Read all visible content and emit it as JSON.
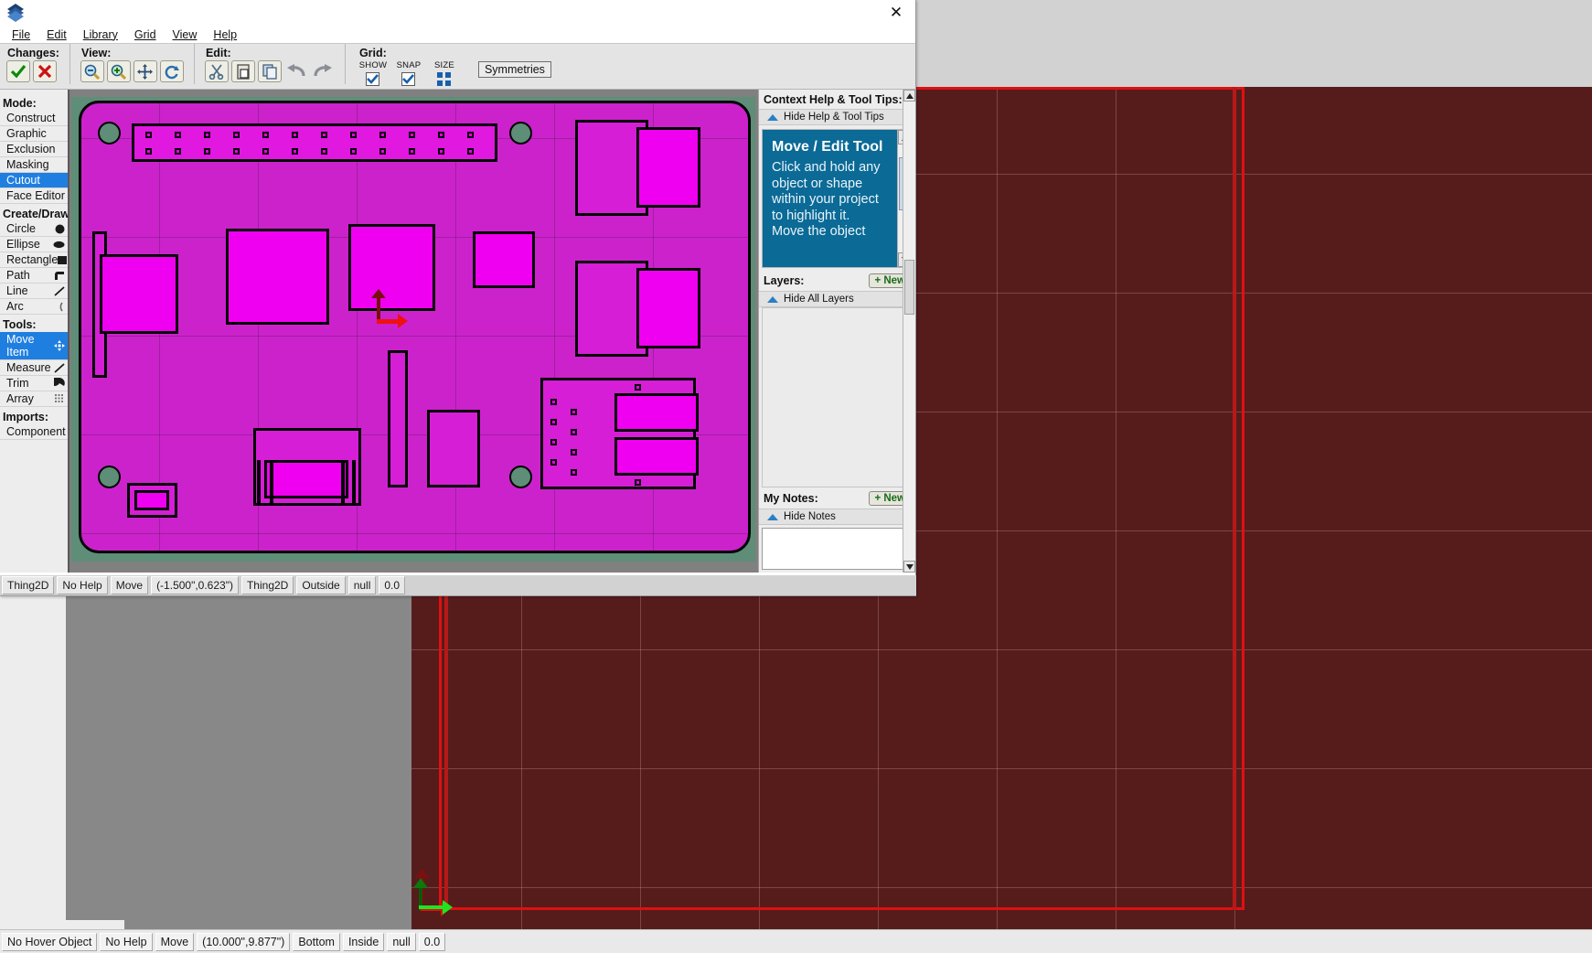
{
  "window": {
    "close_label": "✕",
    "logo_name": "app-logo"
  },
  "menubar": {
    "items": [
      {
        "label": "File"
      },
      {
        "label": "Edit"
      },
      {
        "label": "Library"
      },
      {
        "label": "Grid"
      },
      {
        "label": "View"
      },
      {
        "label": "Help"
      }
    ]
  },
  "toolbar": {
    "groups": [
      {
        "label": "Changes:",
        "buttons": [
          {
            "name": "accept-changes-button",
            "icon": "check-icon"
          },
          {
            "name": "cancel-changes-button",
            "icon": "x-icon"
          }
        ]
      },
      {
        "label": "View:",
        "buttons": [
          {
            "name": "zoom-out-button",
            "icon": "zoom-out-icon"
          },
          {
            "name": "zoom-in-button",
            "icon": "zoom-in-icon"
          },
          {
            "name": "pan-button",
            "icon": "move-arrows-icon"
          },
          {
            "name": "refresh-view-button",
            "icon": "refresh-icon"
          }
        ]
      },
      {
        "label": "Edit:",
        "buttons": [
          {
            "name": "cut-button",
            "icon": "scissors-icon"
          },
          {
            "name": "paste-button",
            "icon": "clipboard-icon"
          },
          {
            "name": "copy-button",
            "icon": "copy-icon"
          },
          {
            "name": "undo-button",
            "icon": "undo-arrow-icon"
          },
          {
            "name": "redo-button",
            "icon": "redo-arrow-icon"
          }
        ]
      }
    ],
    "grid": {
      "label": "Grid:",
      "show_label": "SHOW",
      "snap_label": "SNAP",
      "size_label": "SIZE",
      "show_checked": true,
      "snap_checked": true
    },
    "symmetries_label": "Symmetries"
  },
  "sidebar": {
    "mode": {
      "heading": "Mode:",
      "items": [
        {
          "label": "Construct",
          "selected": false
        },
        {
          "label": "Graphic",
          "selected": false
        },
        {
          "label": "Exclusion",
          "selected": false
        },
        {
          "label": "Masking",
          "selected": false
        },
        {
          "label": "Cutout",
          "selected": true
        },
        {
          "label": "Face Editor",
          "selected": false
        }
      ]
    },
    "create_draw": {
      "heading": "Create/Draw:",
      "items": [
        {
          "label": "Circle",
          "icon": "circle-icon"
        },
        {
          "label": "Ellipse",
          "icon": "ellipse-icon"
        },
        {
          "label": "Rectangle",
          "icon": "rectangle-icon"
        },
        {
          "label": "Path",
          "icon": "path-icon"
        },
        {
          "label": "Line",
          "icon": "line-icon"
        },
        {
          "label": "Arc",
          "icon": "arc-icon"
        }
      ]
    },
    "tools": {
      "heading": "Tools:",
      "items": [
        {
          "label": "Move Item",
          "icon": "move-item-icon",
          "selected": true
        },
        {
          "label": "Measure",
          "icon": "measure-icon",
          "selected": false
        },
        {
          "label": "Trim",
          "icon": "trim-icon",
          "selected": false
        },
        {
          "label": "Array",
          "icon": "array-icon",
          "selected": false
        }
      ]
    },
    "imports": {
      "heading": "Imports:",
      "items": [
        {
          "label": "Component"
        }
      ]
    }
  },
  "help_panel": {
    "header": "Context Help & Tool Tips:",
    "hide_label": "Hide Help & Tool Tips",
    "title": "Move / Edit Tool",
    "body": "Click and hold any object or shape within your project to highlight it.",
    "body_cut": "Move the object"
  },
  "layers_panel": {
    "header": "Layers:",
    "new_label": "+ New",
    "hide_label": "Hide All Layers"
  },
  "notes_panel": {
    "header": "My Notes:",
    "new_label": "+ New",
    "hide_label": "Hide Notes"
  },
  "inner_statusbar": {
    "cells": [
      {
        "name": "hover-object",
        "value": "Thing2D"
      },
      {
        "name": "help-state",
        "value": "No Help"
      },
      {
        "name": "tool-mode",
        "value": "Move"
      },
      {
        "name": "cursor-coords",
        "value": "(-1.500\",0.623\")"
      },
      {
        "name": "object-type",
        "value": "Thing2D"
      },
      {
        "name": "region",
        "value": "Outside"
      },
      {
        "name": "layer",
        "value": "null"
      },
      {
        "name": "depth",
        "value": "0.0"
      }
    ]
  },
  "outer_statusbar": {
    "cells": [
      {
        "name": "hover-object",
        "value": "No Hover Object"
      },
      {
        "name": "help-state",
        "value": "No Help"
      },
      {
        "name": "tool-mode",
        "value": "Move"
      },
      {
        "name": "cursor-coords",
        "value": "(10.000\",9.877\")"
      },
      {
        "name": "face",
        "value": "Bottom"
      },
      {
        "name": "region",
        "value": "Inside"
      },
      {
        "name": "layer",
        "value": "null"
      },
      {
        "name": "depth",
        "value": "0.0"
      }
    ]
  },
  "canvas": {
    "board_color": "#cc22cc",
    "part_color": "#d51ed5",
    "bright_part_color": "#f000f0",
    "background_color": "#5e8d78",
    "hole_count": 4,
    "header_pin_columns": 12,
    "header_pin_rows": 2
  },
  "outer_canvas": {
    "board_color": "#561c1c",
    "outline_color": "#e01010"
  }
}
